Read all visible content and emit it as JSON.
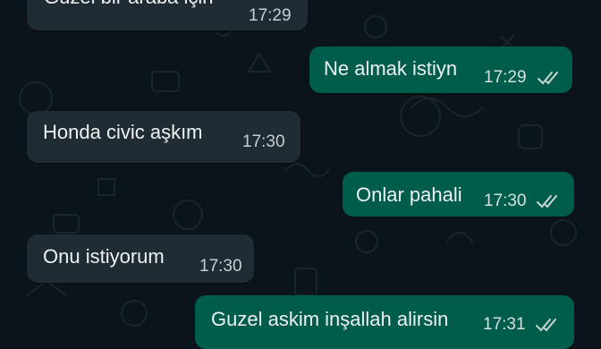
{
  "chat": {
    "messages": [
      {
        "direction": "incoming",
        "text": "Guzel bir araba için",
        "time": "17:29"
      },
      {
        "direction": "outgoing",
        "text": "Ne almak istiyn",
        "time": "17:29",
        "status": "read"
      },
      {
        "direction": "incoming",
        "text": "Honda civic aşkım",
        "time": "17:30"
      },
      {
        "direction": "outgoing",
        "text": "Onlar pahali",
        "time": "17:30",
        "status": "read"
      },
      {
        "direction": "incoming",
        "text": "Onu istiyorum",
        "time": "17:30"
      },
      {
        "direction": "outgoing",
        "text": "Guzel askim inşallah alirsin",
        "time": "17:31",
        "status": "read"
      }
    ]
  },
  "colors": {
    "background": "#0b141a",
    "incoming_bubble": "#202c33",
    "outgoing_bubble": "#005c4b",
    "read_ticks": "#c8d6d0"
  }
}
